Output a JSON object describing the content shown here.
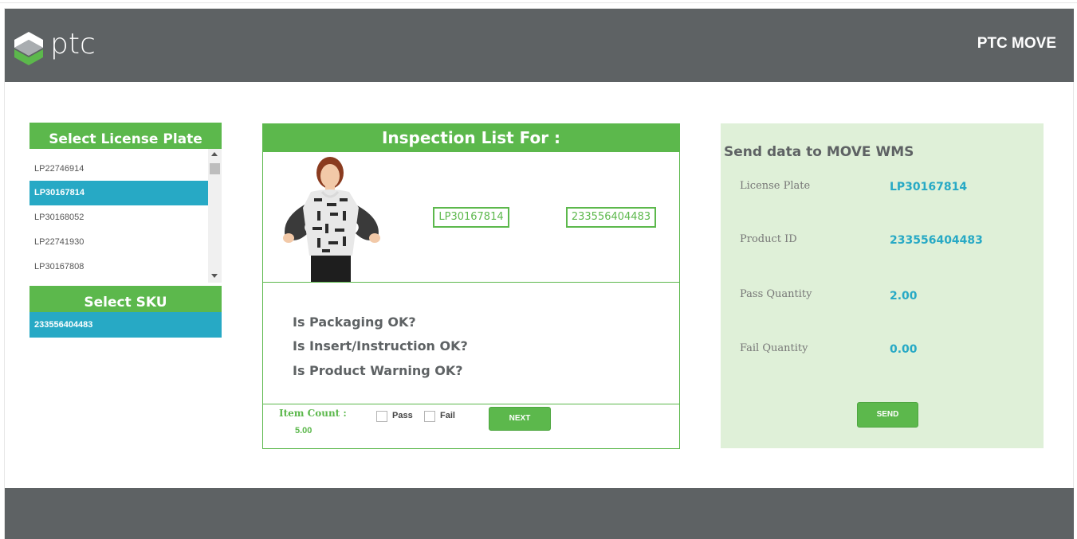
{
  "header": {
    "logo_text": "ptc",
    "app_title": "PTC MOVE"
  },
  "license_plate": {
    "title": "Select License Plate",
    "items": [
      "LP22746914",
      "LP30167814",
      "LP30168052",
      "LP22741930",
      "LP30167808"
    ],
    "selected_index": 1
  },
  "sku": {
    "title": "Select SKU",
    "items": [
      "233556404483"
    ]
  },
  "inspection": {
    "title": "Inspection List For :",
    "license_plate": "LP30167814",
    "product_id": "233556404483",
    "questions": [
      "Is Packaging OK?",
      "Is Insert/Instruction OK?",
      "Is Product Warning OK?"
    ],
    "item_count_label": "Item Count :",
    "item_count_value": "5.00",
    "pass_label": "Pass",
    "fail_label": "Fail",
    "next_label": "NEXT"
  },
  "send": {
    "title": "Send data to MOVE WMS",
    "fields": [
      {
        "label": "License Plate",
        "value": "LP30167814"
      },
      {
        "label": "Product ID",
        "value": "233556404483"
      },
      {
        "label": "Pass Quantity",
        "value": "2.00"
      },
      {
        "label": "Fail Quantity",
        "value": "0.00"
      }
    ],
    "send_label": "SEND"
  },
  "colors": {
    "header_bg": "#5e6264",
    "green": "#5cb84c",
    "blue": "#27a9c5",
    "panel_green": "#dff0d8"
  }
}
